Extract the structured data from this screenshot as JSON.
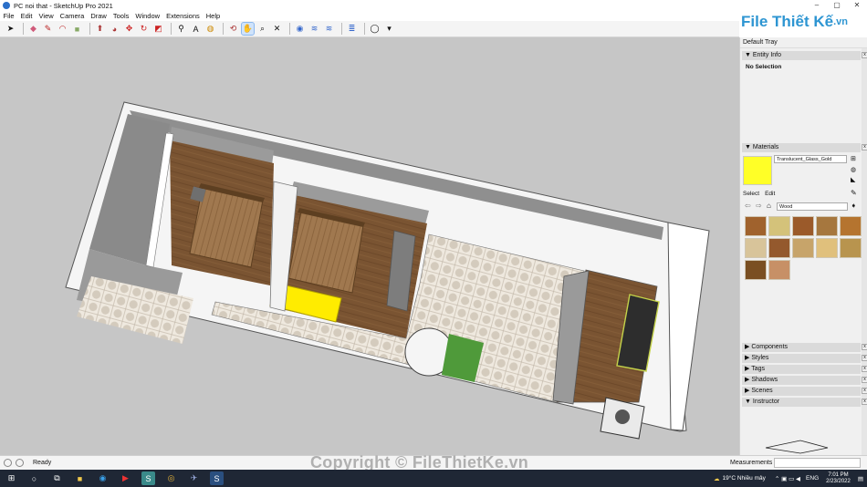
{
  "window": {
    "title": "PC noi that - SketchUp Pro 2021",
    "controls": [
      "–",
      "▢",
      "✕"
    ]
  },
  "menu": [
    "File",
    "Edit",
    "View",
    "Camera",
    "Draw",
    "Tools",
    "Window",
    "Extensions",
    "Help"
  ],
  "toolbar": {
    "tools": [
      "select",
      "eraser",
      "pencil",
      "arc",
      "shape",
      "paint",
      "push-pull",
      "move",
      "rotate",
      "scale",
      "offset",
      "tape",
      "text",
      "protractor",
      "orbit",
      "pan",
      "zoom",
      "zoom-extents",
      "warehouse",
      "extension",
      "layout",
      "styles",
      "account"
    ],
    "active_tool": "pan"
  },
  "logo": {
    "text": "File Thiết Kế",
    "suffix": ".vn",
    "color": "#2d95d2"
  },
  "tray": {
    "title": "Default Tray",
    "entity_info": {
      "label": "Entity Info",
      "status": "No Selection"
    },
    "materials": {
      "label": "Materials",
      "current": "Translucent_Glass_Gold",
      "current_color": "#ffff27",
      "tabs": [
        "Select",
        "Edit"
      ],
      "collection": "Wood",
      "swatches": [
        "#a0622d",
        "#d4c27a",
        "#9b5a2a",
        "#a6773e",
        "#b5742f",
        "#d8c49a",
        "#94592d",
        "#c7a46a",
        "#e0c07c",
        "#b8944e",
        "#7a4f22",
        "#c79066"
      ]
    },
    "panels": [
      "Components",
      "Styles",
      "Tags",
      "Shadows",
      "Scenes",
      "Instructor"
    ]
  },
  "status": {
    "ready": "Ready",
    "measurements_label": "Measurements"
  },
  "watermark": "Copyright © FileThietKe.vn",
  "taskbar": {
    "weather": "19°C  Nhiều mây",
    "lang": "ENG",
    "time": "7:01 PM",
    "date": "2/23/2022"
  }
}
